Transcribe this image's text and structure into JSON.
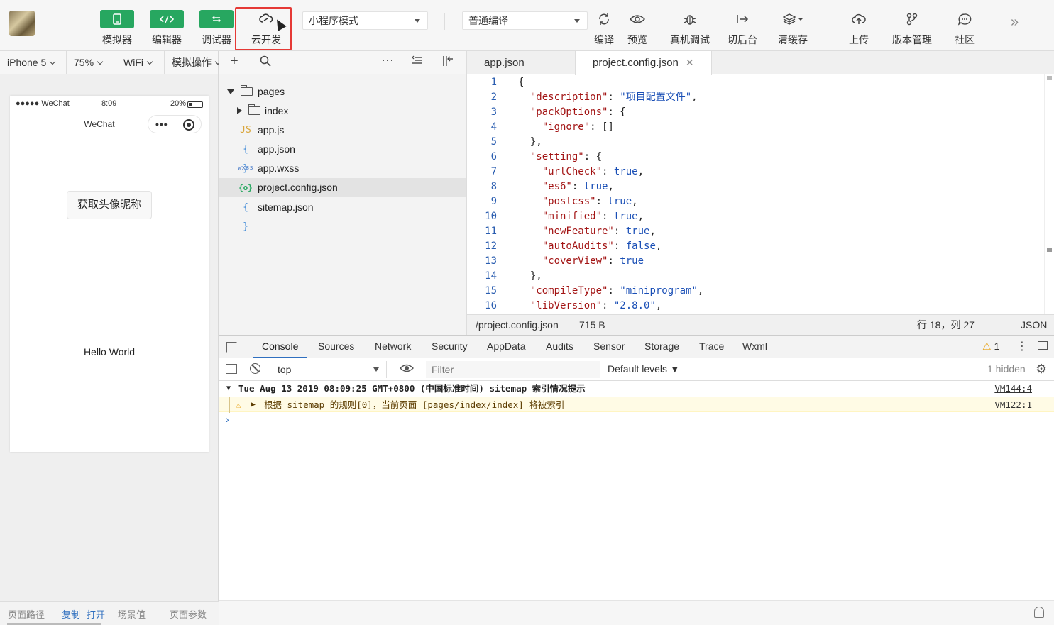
{
  "toolbar": {
    "buttons": [
      {
        "label": "模拟器"
      },
      {
        "label": "编辑器"
      },
      {
        "label": "调试器"
      },
      {
        "label": "云开发"
      }
    ],
    "mode_select": "小程序模式",
    "compile_select": "普通编译",
    "actions": [
      {
        "label": "编译"
      },
      {
        "label": "预览"
      },
      {
        "label": "真机调试"
      },
      {
        "label": "切后台"
      },
      {
        "label": "清缓存"
      },
      {
        "label": "上传"
      },
      {
        "label": "版本管理"
      },
      {
        "label": "社区"
      }
    ]
  },
  "simulator": {
    "device": "iPhone 5",
    "zoom": "75%",
    "network": "WiFi",
    "ops": "模拟操作",
    "status_carrier": "●●●●● WeChat",
    "status_time": "8:09",
    "status_battery": "20%",
    "nav_title": "WeChat",
    "button_label": "获取头像昵称",
    "hello_text": "Hello World",
    "footer": {
      "path": "页面路径",
      "copy": "复制",
      "open": "打开",
      "scene": "场景值",
      "params": "页面参数"
    }
  },
  "file_tree": {
    "items": [
      {
        "name": "pages",
        "type": "folder",
        "expanded": true
      },
      {
        "name": "index",
        "type": "folder",
        "expanded": false
      },
      {
        "name": "app.js",
        "type": "js"
      },
      {
        "name": "app.json",
        "type": "json"
      },
      {
        "name": "app.wxss",
        "type": "wxss"
      },
      {
        "name": "project.config.json",
        "type": "config",
        "selected": true
      },
      {
        "name": "sitemap.json",
        "type": "json"
      }
    ],
    "icon_labels": {
      "js": "JS",
      "json": "{ }",
      "wxss": "wxss",
      "config": "{o}"
    }
  },
  "editor": {
    "tabs": [
      {
        "label": "app.json",
        "active": false
      },
      {
        "label": "project.config.json",
        "active": true
      }
    ],
    "lines": [
      {
        "n": "1",
        "t": "{"
      },
      {
        "n": "2",
        "t": "  \"description\": \"项目配置文件\","
      },
      {
        "n": "3",
        "t": "  \"packOptions\": {"
      },
      {
        "n": "4",
        "t": "    \"ignore\": []"
      },
      {
        "n": "5",
        "t": "  },"
      },
      {
        "n": "6",
        "t": "  \"setting\": {"
      },
      {
        "n": "7",
        "t": "    \"urlCheck\": true,"
      },
      {
        "n": "8",
        "t": "    \"es6\": true,"
      },
      {
        "n": "9",
        "t": "    \"postcss\": true,"
      },
      {
        "n": "10",
        "t": "    \"minified\": true,"
      },
      {
        "n": "11",
        "t": "    \"newFeature\": true,"
      },
      {
        "n": "12",
        "t": "    \"autoAudits\": false,"
      },
      {
        "n": "13",
        "t": "    \"coverView\": true"
      },
      {
        "n": "14",
        "t": "  },"
      },
      {
        "n": "15",
        "t": "  \"compileType\": \"miniprogram\","
      },
      {
        "n": "16",
        "t": "  \"libVersion\": \"2.8.0\","
      }
    ],
    "status": {
      "path": "/project.config.json",
      "size": "715 B",
      "position": "行 18，列 27",
      "language": "JSON"
    }
  },
  "devtools": {
    "tabs": [
      "Console",
      "Sources",
      "Network",
      "Security",
      "AppData",
      "Audits",
      "Sensor",
      "Storage",
      "Trace",
      "Wxml"
    ],
    "active_tab": "Console",
    "warning_count": "1",
    "context": "top",
    "filter_placeholder": "Filter",
    "levels": "Default levels ▼",
    "hidden": "1 hidden",
    "log_group": "Tue Aug 13 2019 08:09:25 GMT+0800 (中国标准时间) sitemap 索引情况提示",
    "log_group_src": "VM144:4",
    "log_warn": "根据 sitemap 的规则[0]，当前页面 [pages/index/index] 将被索引",
    "log_warn_src": "VM122:1"
  },
  "colors": {
    "accent_green": "#27a760",
    "highlight_red": "#e53935",
    "link_blue": "#2f6fbf"
  }
}
